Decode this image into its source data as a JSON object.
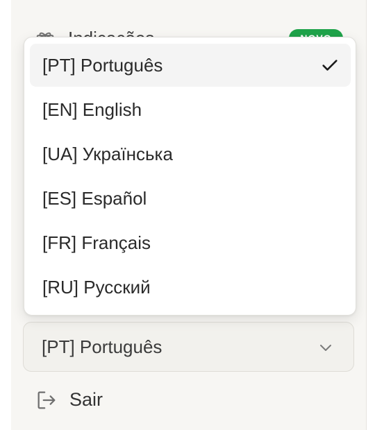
{
  "nav": {
    "referrals_label": "Indicações",
    "referrals_badge": "NOVO",
    "referrals_icon": "gift-icon"
  },
  "language_dropdown": {
    "options": [
      {
        "label": "[PT] Português",
        "selected": true
      },
      {
        "label": "[EN] English",
        "selected": false
      },
      {
        "label": "[UA] Українська",
        "selected": false
      },
      {
        "label": "[ES] Español",
        "selected": false
      },
      {
        "label": "[FR] Français",
        "selected": false
      },
      {
        "label": "[RU] Русский",
        "selected": false
      }
    ],
    "selected_icon": "check-icon"
  },
  "language_select": {
    "value": "[PT] Português",
    "icon": "chevron-down-icon"
  },
  "logout": {
    "label": "Sair",
    "icon": "logout-icon"
  },
  "colors": {
    "sidebar_bg": "#f7f6f3",
    "badge_green": "#1fa34a",
    "selected_row": "#f4f4f4"
  }
}
